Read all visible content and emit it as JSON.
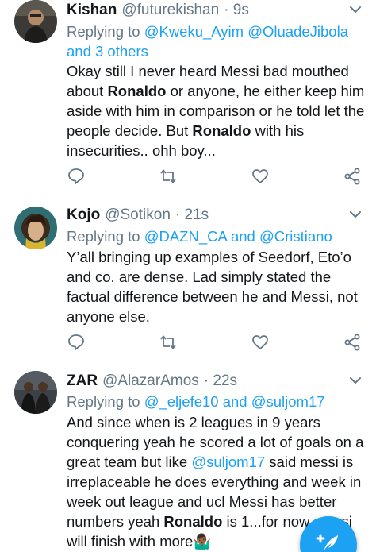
{
  "tweets": [
    {
      "name": "Kishan",
      "handle": "@futurekishan",
      "time": "· 9s",
      "replying_prefix": "Replying to ",
      "replying_mention_1": "@Kweku_Ayim",
      "replying_mention_2": "@OluadeJibola",
      "replying_mention_3": "and 3 others",
      "body_1": "Okay still I never heard Messi bad mouthed about ",
      "body_bold_1": "Ronaldo",
      "body_2": " or anyone, he either keep him aside with him in comparison or he told let the people decide. But ",
      "body_bold_2": "Ronaldo",
      "body_3": " with his insecurities.. ohh boy..."
    },
    {
      "name": "Kojo",
      "handle": "@Sotikon",
      "time": "· 21s",
      "replying_prefix": "Replying to ",
      "replying_mention_1": "@DAZN_CA",
      "replying_and": " and ",
      "replying_mention_2": "@Cristiano",
      "body": "Y’all bringing up examples of Seedorf, Eto’o and co. are dense. Lad simply stated the factual difference between he and Messi, not anyone else."
    },
    {
      "name": "ZAR",
      "handle": "@AlazarAmos",
      "time": "· 22s",
      "replying_prefix": "Replying to ",
      "replying_mention_1": "@_eljefe10",
      "replying_and": " and ",
      "replying_mention_2": "@suljom17",
      "body_1": "And since when is 2 leagues in 9 years conquering yeah he scored a lot of goals on a great team but like ",
      "body_mention": "@suljom17",
      "body_2": " said messi is irreplaceable he does everything and week in week out league and ucl Messi has better numbers yeah ",
      "body_bold": "Ronaldo",
      "body_3": " is 1...for now messi will finish with more",
      "body_emoji": "🤷🏾‍♂️"
    }
  ],
  "icons": {
    "reply": "reply-icon",
    "retweet": "retweet-icon",
    "like": "like-icon",
    "share": "share-icon",
    "menu": "chevron-down-icon",
    "compose": "compose-tweet-icon"
  },
  "colors": {
    "accent": "#1da1f2",
    "secondary_text": "#657786",
    "divider": "#e1e8ed"
  }
}
